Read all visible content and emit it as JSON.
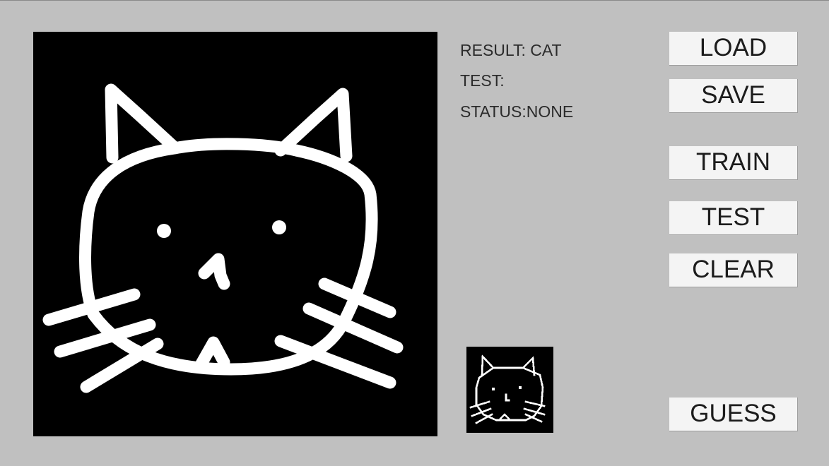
{
  "drawing": {
    "icon": "cat-drawing",
    "stroke_color": "#ffffff",
    "background_color": "#000000"
  },
  "thumbnail": {
    "icon": "cat-drawing-thumbnail",
    "stroke_color": "#ffffff",
    "background_color": "#000000"
  },
  "info": {
    "result": "RESULT: CAT",
    "test": "TEST:",
    "status": "STATUS:NONE"
  },
  "buttons": {
    "load": "LOAD",
    "save": "SAVE",
    "train": "TRAIN",
    "test": "TEST",
    "clear": "CLEAR",
    "guess": "GUESS"
  },
  "colors": {
    "background": "#c0c0c0",
    "button_face": "#f4f4f4",
    "text": "#2b2b2b"
  }
}
